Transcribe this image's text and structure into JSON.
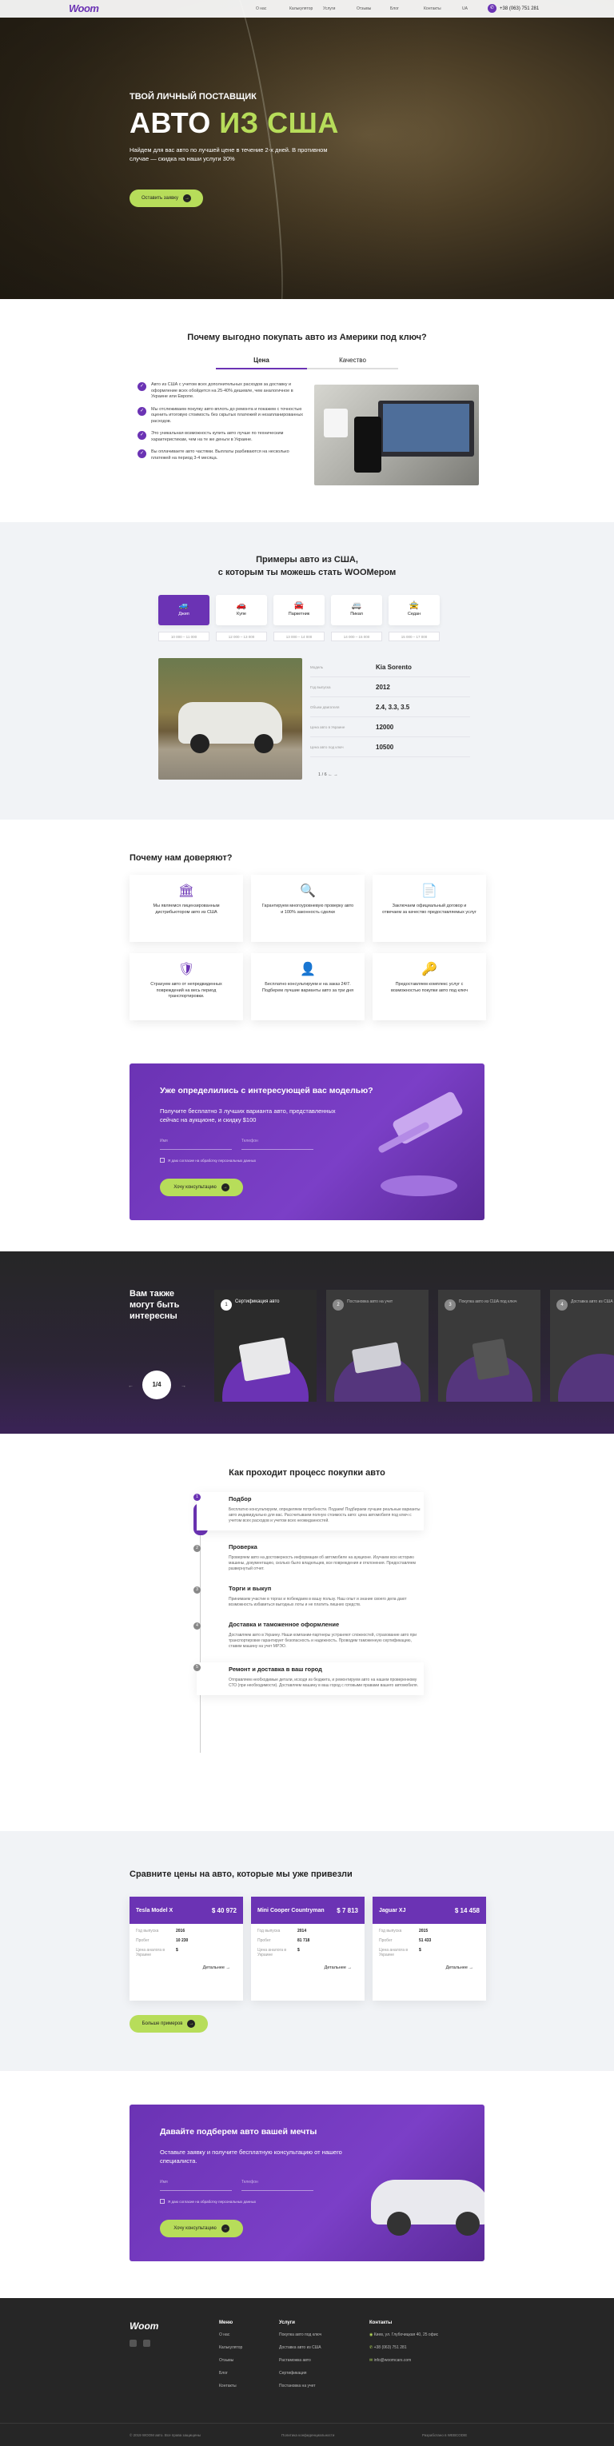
{
  "header": {
    "logo": "Woom",
    "nav": [
      "О нас",
      "Калькулятор",
      "Услуги",
      "Отзывы",
      "Блог",
      "Контакты"
    ],
    "lang": "UA",
    "phone": "+38 (063) 751 281"
  },
  "hero": {
    "subtitle": "ТВОЙ ЛИЧНЫЙ ПОСТАВЩИК",
    "title_white": "АВТО ",
    "title_green": "ИЗ США",
    "desc": "Найдем для вас авто по лучшей цене в течение 2-х дней. В противном случае — скидка на наши услуги 30%",
    "cta": "Оставить заявку",
    "cta_icon": "→"
  },
  "why": {
    "title": "Почему выгодно покупать авто из Америки под ключ?",
    "tabs": [
      "Цена",
      "Качество"
    ],
    "items": [
      "Авто из США с учетом всех дополнительных расходов за доставку и оформление всех обойдется на 25-40% дешевле, чем аналогичное в Украине или Европе.",
      "Мы отслеживаем покупку авто вплоть до ремонта и покажем с точностью оценить итоговую стоимость без скрытых платежей и незапланированных расходов.",
      "Это уникальная возможность купить авто лучше по техническим характеристикам, чем на те же деньги в Украине.",
      "Вы оплачиваете авто частями. Выплаты разбиваются на несколько платежей на период 3-4 месяца."
    ]
  },
  "examples": {
    "title_line1": "Примеры авто из США,",
    "title_line2": "с которым ты можешь стать WOOMером",
    "tabs": [
      {
        "icon": "🚙",
        "label": "Джип",
        "active": true
      },
      {
        "icon": "🚗",
        "label": "Купе"
      },
      {
        "icon": "🚘",
        "label": "Паркетник"
      },
      {
        "icon": "🚐",
        "label": "Пикап"
      },
      {
        "icon": "🚖",
        "label": "Седан"
      }
    ],
    "prices": [
      "10 000 – 11 000",
      "12 000 – 13 000",
      "13 000 – 14 000",
      "14 000 – 15 000",
      "15 000 – 17 000"
    ],
    "specs": [
      {
        "k": "Модель",
        "v": "Kia Sorento"
      },
      {
        "k": "Год выпуска",
        "v": "2012"
      },
      {
        "k": "Объем двигателя",
        "v": "2.4, 3.3, 3.5"
      },
      {
        "k": "Цена авто в Украине",
        "v": "12000"
      },
      {
        "k": "Цена авто под ключ",
        "v": "10500"
      }
    ],
    "pager": "1 / 6   ←   →"
  },
  "trust": {
    "title": "Почему нам доверяют?",
    "cards": [
      {
        "icon": "🏛",
        "text": "Мы являемся лицензированным дистрибьютором авто из США"
      },
      {
        "icon": "🔍",
        "text": "Гарантируем многоуровневую проверку авто и 100% законность сделки"
      },
      {
        "icon": "📄",
        "text": "Заключаем официальный договор и отвечаем за качество предоставляемых услуг"
      },
      {
        "icon": "🛡",
        "text": "Страхуем авто от непредвиденных повреждений на весь период транспортировки."
      },
      {
        "icon": "👤",
        "text": "Бесплатно консультируем и на заказ 24/7. Подберем лучшие варианты авто за три дня"
      },
      {
        "icon": "🔑",
        "text": "Предоставляем комплекс услуг с возможностью покупки авто под ключ"
      }
    ]
  },
  "cta1": {
    "title": "Уже определились с интересующей вас моделью?",
    "desc": "Получите бесплатно 3 лучших варианта авто, представленных сейчас на аукционе, и скидку $100",
    "field1": "Имя",
    "field2": "Телефон",
    "agree": "Я даю согласие на обработку персональных данных",
    "btn": "Хочу консультацию",
    "btn_icon": "→"
  },
  "dark": {
    "title": "Вам также могут быть интересны",
    "counter": "1/4",
    "arrows": [
      "←",
      "→"
    ],
    "slides": [
      {
        "n": "1",
        "t": "Сертификация авто"
      },
      {
        "n": "2",
        "t": "Постановка авто на учет"
      },
      {
        "n": "3",
        "t": "Покупка авто из США под ключ"
      },
      {
        "n": "4",
        "t": "Доставка авто из США"
      }
    ]
  },
  "process": {
    "title": "Как проходит процесс покупки авто",
    "steps": [
      {
        "n": "1",
        "t": "Подбор",
        "d": "Бесплатно консультируем, определяем потребности. Подаем! Подбираем лучшие реальные варианты авто индивидуально для вас. Рассчитываем полную стоимость авто: цена автомобиля под ключ с учетом всех расходов и учетом всех неожиданностей."
      },
      {
        "n": "2",
        "t": "Проверка",
        "d": "Проверяем авто на достоверность информации об автомобиле на аукционе. Изучаем всю историю машины, документацию, сколько было владельцев, все повреждения и отклонения. Предоставляем развернутый отчет."
      },
      {
        "n": "3",
        "t": "Торги и выкуп",
        "d": "Принимаем участие в торгах и побеждаем в вашу пользу. Наш опыт и знание своего дела дают возможность избавиться выгодных лоты и не платить лишних средств."
      },
      {
        "n": "4",
        "t": "Доставка и таможенное оформление",
        "d": "Доставляем авто в Украину. Наши компании-партнеры устраняют сложностей, страхование авто при транспортировке гарантирует безопасность и надежность. Проводим таможенную сертификацию, ставим машину на учет МРЭО."
      },
      {
        "n": "5",
        "t": "Ремонт и доставка в ваш город",
        "d": "Отправляем необходимые детали, исходя из бюджета, и ремонтируем авто на нашем проверенному СТО (при необходимости). Доставляем машину в ваш город с готовыми правами вашего автомобиля."
      }
    ]
  },
  "compare": {
    "title": "Сравните цены на авто, которые мы уже привезли",
    "cards": [
      {
        "name": "Tesla Model X",
        "price": "$ 40 972",
        "rows": [
          [
            "Год выпуска",
            "2016"
          ],
          [
            "Пробег",
            "10 230"
          ],
          [
            "Цена аналога в Украине",
            "$"
          ]
        ]
      },
      {
        "name": "Mini Cooper Countryman",
        "price": "$ 7 813",
        "rows": [
          [
            "Год выпуска",
            "2014"
          ],
          [
            "Пробег",
            "81 718"
          ],
          [
            "Цена аналога в Украине",
            "$"
          ]
        ]
      },
      {
        "name": "Jaguar XJ",
        "price": "$ 14 458",
        "rows": [
          [
            "Год выпуска",
            "2015"
          ],
          [
            "Пробег",
            "51 433"
          ],
          [
            "Цена аналога в Украине",
            "$"
          ]
        ]
      }
    ],
    "details": "Детальнее",
    "details_icon": "→",
    "more": "Больше примеров",
    "more_icon": "→"
  },
  "cta2": {
    "title": "Давайте подберем авто вашей мечты",
    "desc": "Оставьте заявку и получите бесплатную консультацию от нашего специалиста.",
    "field1": "Имя",
    "field2": "Телефон",
    "agree": "Я даю согласие на обработку персональных данных",
    "btn": "Хочу консультацию",
    "btn_icon": "→"
  },
  "footer": {
    "logo": "Woom",
    "menu_title": "Меню",
    "menu": [
      "О нас",
      "Калькулятор",
      "Отзывы",
      "Блог",
      "Контакты"
    ],
    "services_title": "Услуги",
    "services": [
      "Покупка авто под ключ",
      "Доставка авто из США",
      "Растаможка авто",
      "Сертификация",
      "Постановка на учет"
    ],
    "contacts_title": "Контакты",
    "address": "Киев, ул. Глубочицкая 40, 25 офис",
    "phone": "+38 (063) 751 281",
    "email": "info@woomcars.com",
    "copy": "© 2019 WOOM авто. Все права защищены",
    "privacy": "Политика конфиденциальности",
    "dev": "Разработано в WEBCODIE",
    "socials": [
      "instagram",
      "facebook"
    ]
  }
}
